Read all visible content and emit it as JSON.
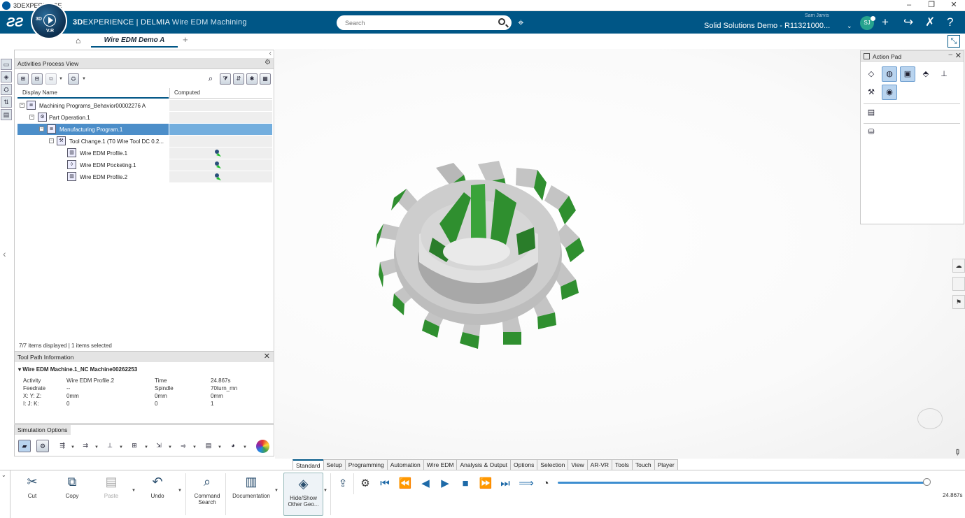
{
  "os": {
    "title": "3DEXPERIENCE",
    "buttons": [
      "–",
      "❐",
      "✕"
    ]
  },
  "brand": {
    "part1": "3D",
    "part2": "EXPERIENCE | DELMIA",
    "app": "Wire EDM Machining"
  },
  "compass": {
    "label_3d": "3D",
    "label_v": "V.R"
  },
  "search": {
    "placeholder": "Search"
  },
  "user": {
    "name": "Sam Jarvis",
    "tenant": "Solid Solutions Demo - R11321000...",
    "initials": "SJ"
  },
  "top_icons": [
    "+",
    "share",
    "tools",
    "help"
  ],
  "tabs": {
    "document": "Wire EDM Demo A",
    "add": "+"
  },
  "activities": {
    "title": "Activities Process View",
    "columns": [
      "Display Name",
      "Computed"
    ],
    "rows": [
      {
        "label": "Machining Programs_Behavior00002276 A",
        "level": 0,
        "computed": false
      },
      {
        "label": "Part Operation.1",
        "level": 1,
        "computed": false
      },
      {
        "label": "Manufacturing Program.1",
        "level": 2,
        "computed": false,
        "selected": true
      },
      {
        "label": "Tool Change.1 (T0 Wire Tool DC 0.2...",
        "level": 3,
        "computed": false
      },
      {
        "label": "Wire EDM Profile.1",
        "level": 4,
        "computed": true
      },
      {
        "label": "Wire EDM Pocketing.1",
        "level": 4,
        "computed": true
      },
      {
        "label": "Wire EDM Profile.2",
        "level": 4,
        "computed": true
      }
    ],
    "footer": "7/7 items displayed | 1 items selected"
  },
  "toolpath": {
    "title": "Tool Path Information",
    "machine": "▾ Wire EDM Machine.1_NC Machine00262253",
    "rows": [
      [
        "Activity",
        "Wire EDM Profile.2",
        "Time",
        "24.867s"
      ],
      [
        "Feedrate",
        "--",
        "Spindle",
        "70turn_mn"
      ],
      [
        "X: Y: Z:",
        "0mm",
        "0mm",
        "0mm"
      ],
      [
        "I: J: K:",
        "0",
        "0",
        "1"
      ]
    ]
  },
  "simulation": {
    "title": "Simulation Options"
  },
  "action_pad": {
    "title": "Action Pad"
  },
  "action_tabs": [
    "Standard",
    "Setup",
    "Programming",
    "Automation",
    "Wire EDM",
    "Analysis & Output",
    "Options",
    "Selection",
    "View",
    "AR-VR",
    "Tools",
    "Touch",
    "Player"
  ],
  "commands": {
    "cut": "Cut",
    "copy": "Copy",
    "paste": "Paste",
    "undo": "Undo",
    "command_search_1": "Command",
    "command_search_2": "Search",
    "documentation": "Documentation",
    "hideshow_1": "Hide/Show",
    "hideshow_2": "Other Geo..."
  },
  "player": {
    "time": "24.867s",
    "progress": 1.0
  },
  "colors": {
    "brand_blue": "#005686",
    "selection": "#4c8ec9",
    "gear_green": "#2f8f2f",
    "gear_grey": "#c9c9c9"
  }
}
